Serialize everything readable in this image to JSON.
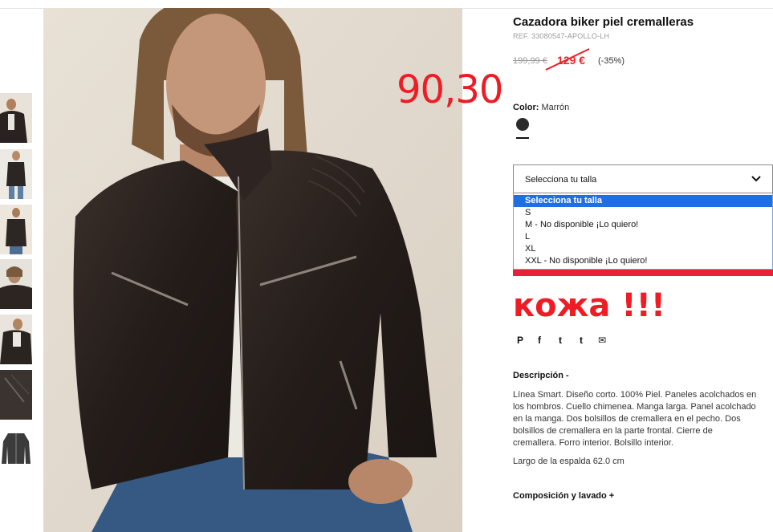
{
  "product": {
    "title": "Cazadora biker piel cremalleras",
    "ref": "REF. 33080547-APOLLO-LH",
    "price_old": "199,99 €",
    "price_new": "129 €",
    "discount": "(-35%)"
  },
  "annotations": {
    "price": "90,30",
    "note": "кожа !!!"
  },
  "color": {
    "label": "Color:",
    "value": "Marrón",
    "swatch_hex": "#2b2b2b"
  },
  "size": {
    "select_label": "Selecciona tu talla",
    "options": [
      "Selecciona tu talla",
      "S",
      "M - No disponible ¡Lo quiero!",
      "L",
      "XL",
      "XXL - No disponible ¡Lo quiero!"
    ]
  },
  "social": {
    "pinterest": "P",
    "facebook": "f",
    "twitter": "t",
    "tumblr": "t",
    "email": "✉"
  },
  "description": {
    "heading": "Descripción -",
    "lines": [
      "Línea Smart. Diseño corto. 100% Piel. Paneles acolchados en",
      "los hombros. Cuello chimenea. Manga larga. Panel acolchado",
      "en la manga. Dos bolsillos de cremallera en el pecho. Dos",
      "bolsillos de cremallera en la parte frontal. Cierre de",
      "cremallera. Forro interior. Bolsillo interior."
    ],
    "back_length": "Largo de la espalda 62.0 cm",
    "composition": "Composición y lavado +"
  },
  "colors": {
    "accent_red": "#e8262a",
    "annotation_red": "#ee1c24",
    "selected_blue": "#1e6fe3"
  }
}
